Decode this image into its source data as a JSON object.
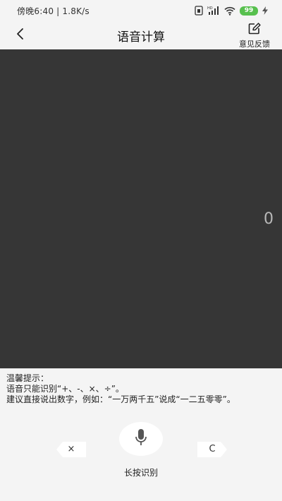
{
  "status_bar": {
    "left_text": "傍晚6:40 | 1.8K/s",
    "battery_level": "99",
    "icons": [
      "sim-icon",
      "hd-signal-icon",
      "wifi-icon",
      "battery-icon",
      "charging-icon"
    ],
    "battery_color": "#57c04e"
  },
  "header": {
    "title": "语音计算",
    "back_icon": "chevron-left-icon",
    "feedback_label": "意见反馈",
    "feedback_icon": "edit-icon"
  },
  "display": {
    "value": "0",
    "background": "#363636"
  },
  "hints": {
    "heading": "温馨提示：",
    "line1": "语音只能识别“+、-、×、÷”。",
    "line2": "建议直接说出数字，例如：“一万两千五”说成“一二五零零”。"
  },
  "controls": {
    "backspace_label": "×",
    "clear_label": "C",
    "mic_icon": "microphone-icon",
    "mic_label": "长按识别"
  }
}
